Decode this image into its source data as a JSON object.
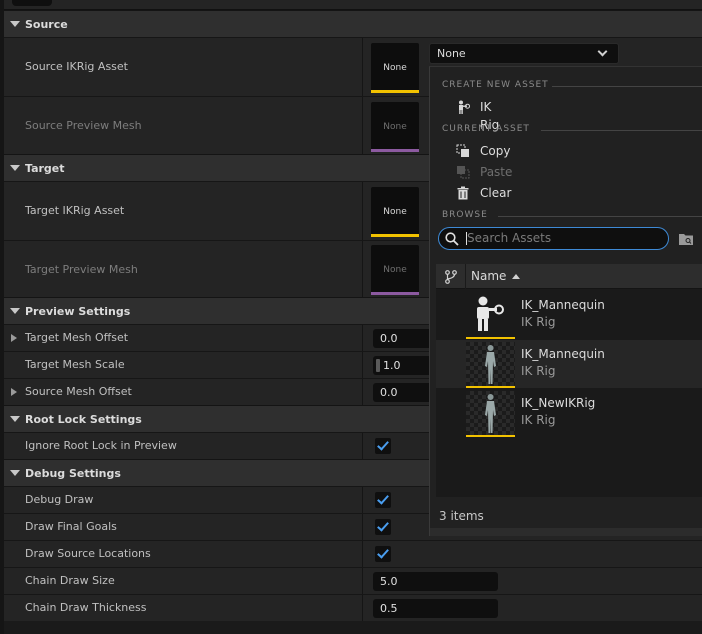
{
  "categories": {
    "source": "Source",
    "target": "Target",
    "preview": "Preview Settings",
    "rootlock": "Root Lock Settings",
    "debug": "Debug Settings"
  },
  "source": {
    "ikrig_label": "Source IKRig Asset",
    "ikrig_thumb": "None",
    "mesh_label": "Source Preview Mesh",
    "mesh_thumb": "None",
    "combo_value": "None"
  },
  "target": {
    "ikrig_label": "Target IKRig Asset",
    "ikrig_thumb": "None",
    "mesh_label": "Target Preview Mesh",
    "mesh_thumb": "None"
  },
  "preview": {
    "offset_label": "Target Mesh Offset",
    "offset_value": "0.0",
    "scale_label": "Target Mesh Scale",
    "scale_value": "1.0",
    "src_offset_label": "Source Mesh Offset",
    "src_offset_value": "0.0"
  },
  "rootlock": {
    "ignore_label": "Ignore Root Lock in Preview",
    "ignore_checked": true
  },
  "debug": {
    "draw_label": "Debug Draw",
    "final_goals_label": "Draw Final Goals",
    "source_loc_label": "Draw Source Locations",
    "chain_size_label": "Chain Draw Size",
    "chain_size_value": "5.0",
    "chain_thick_label": "Chain Draw Thickness",
    "chain_thick_value": "0.5"
  },
  "menu": {
    "create_header": "CREATE NEW ASSET",
    "ikrig_item": "IK Rig",
    "current_header": "CURRENT ASSET",
    "copy": "Copy",
    "paste": "Paste",
    "clear": "Clear",
    "browse_header": "BROWSE",
    "search_placeholder": "Search Assets",
    "column_name": "Name",
    "items": [
      {
        "name": "IK_Mannequin",
        "type": "IK Rig"
      },
      {
        "name": "IK_Mannequin",
        "type": "IK Rig"
      },
      {
        "name": "IK_NewIKRig",
        "type": "IK Rig"
      }
    ],
    "count": "3 items"
  },
  "colors": {
    "ikrig_bar": "#f2c200",
    "mesh_bar": "#8c5aa0",
    "accent": "#4a9ef0"
  }
}
